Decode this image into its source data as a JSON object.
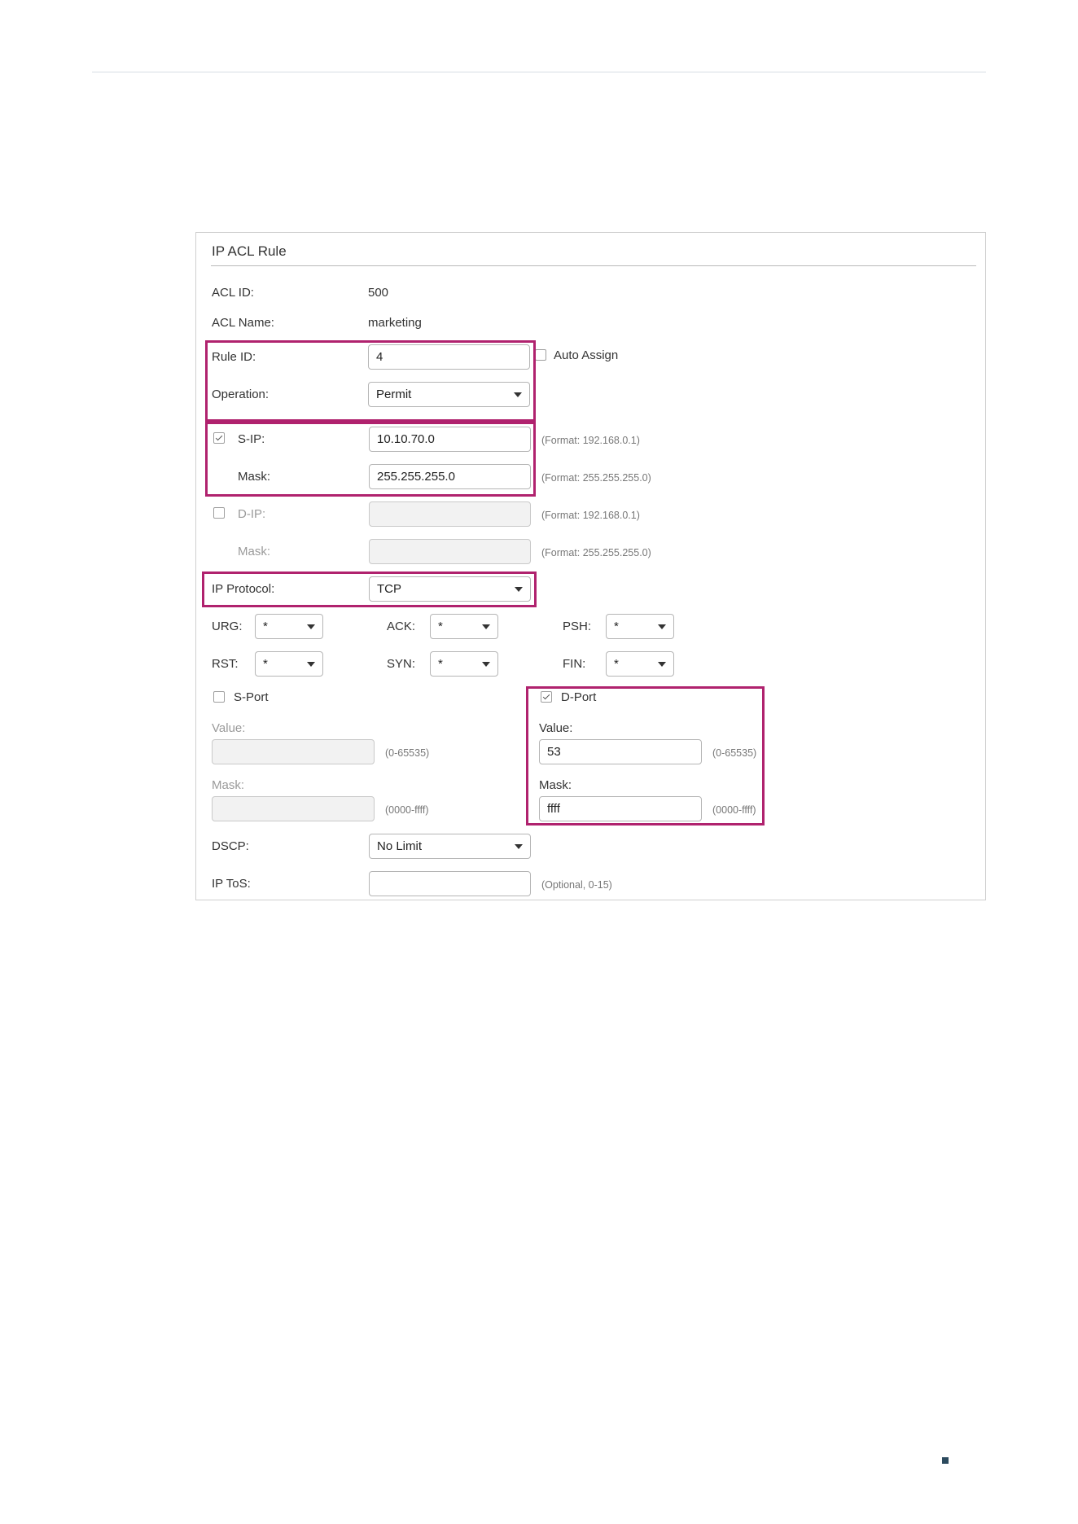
{
  "panel": {
    "title": "IP ACL Rule"
  },
  "acl_id": {
    "label": "ACL ID:",
    "value": "500"
  },
  "acl_name": {
    "label": "ACL Name:",
    "value": "marketing"
  },
  "rule_id": {
    "label": "Rule ID:",
    "value": "4",
    "auto_assign_label": "Auto Assign",
    "auto_assign_checked": false
  },
  "operation": {
    "label": "Operation:",
    "selected": "Permit"
  },
  "s_ip": {
    "label": "S-IP:",
    "checked": true,
    "value": "10.10.70.0",
    "hint": "(Format: 192.168.0.1)",
    "mask_label": "Mask:",
    "mask_value": "255.255.255.0",
    "mask_hint": "(Format: 255.255.255.0)"
  },
  "d_ip": {
    "label": "D-IP:",
    "checked": false,
    "value": "",
    "hint": "(Format: 192.168.0.1)",
    "mask_label": "Mask:",
    "mask_value": "",
    "mask_hint": "(Format: 255.255.255.0)"
  },
  "ip_protocol": {
    "label": "IP Protocol:",
    "selected": "TCP"
  },
  "tcp_flags": {
    "urg": {
      "label": "URG:",
      "selected": "*"
    },
    "ack": {
      "label": "ACK:",
      "selected": "*"
    },
    "psh": {
      "label": "PSH:",
      "selected": "*"
    },
    "rst": {
      "label": "RST:",
      "selected": "*"
    },
    "syn": {
      "label": "SYN:",
      "selected": "*"
    },
    "fin": {
      "label": "FIN:",
      "selected": "*"
    }
  },
  "s_port": {
    "label": "S-Port",
    "checked": false,
    "value_label": "Value:",
    "value": "",
    "value_hint": "(0-65535)",
    "mask_label": "Mask:",
    "mask_value": "",
    "mask_hint": "(0000-ffff)"
  },
  "d_port": {
    "label": "D-Port",
    "checked": true,
    "value_label": "Value:",
    "value": "53",
    "value_hint": "(0-65535)",
    "mask_label": "Mask:",
    "mask_value": "ffff",
    "mask_hint": "(0000-ffff)"
  },
  "dscp": {
    "label": "DSCP:",
    "selected": "No Limit"
  },
  "ip_tos": {
    "label": "IP ToS:",
    "value": "",
    "hint": "(Optional, 0-15)"
  },
  "colors": {
    "highlight": "#b0226e"
  }
}
